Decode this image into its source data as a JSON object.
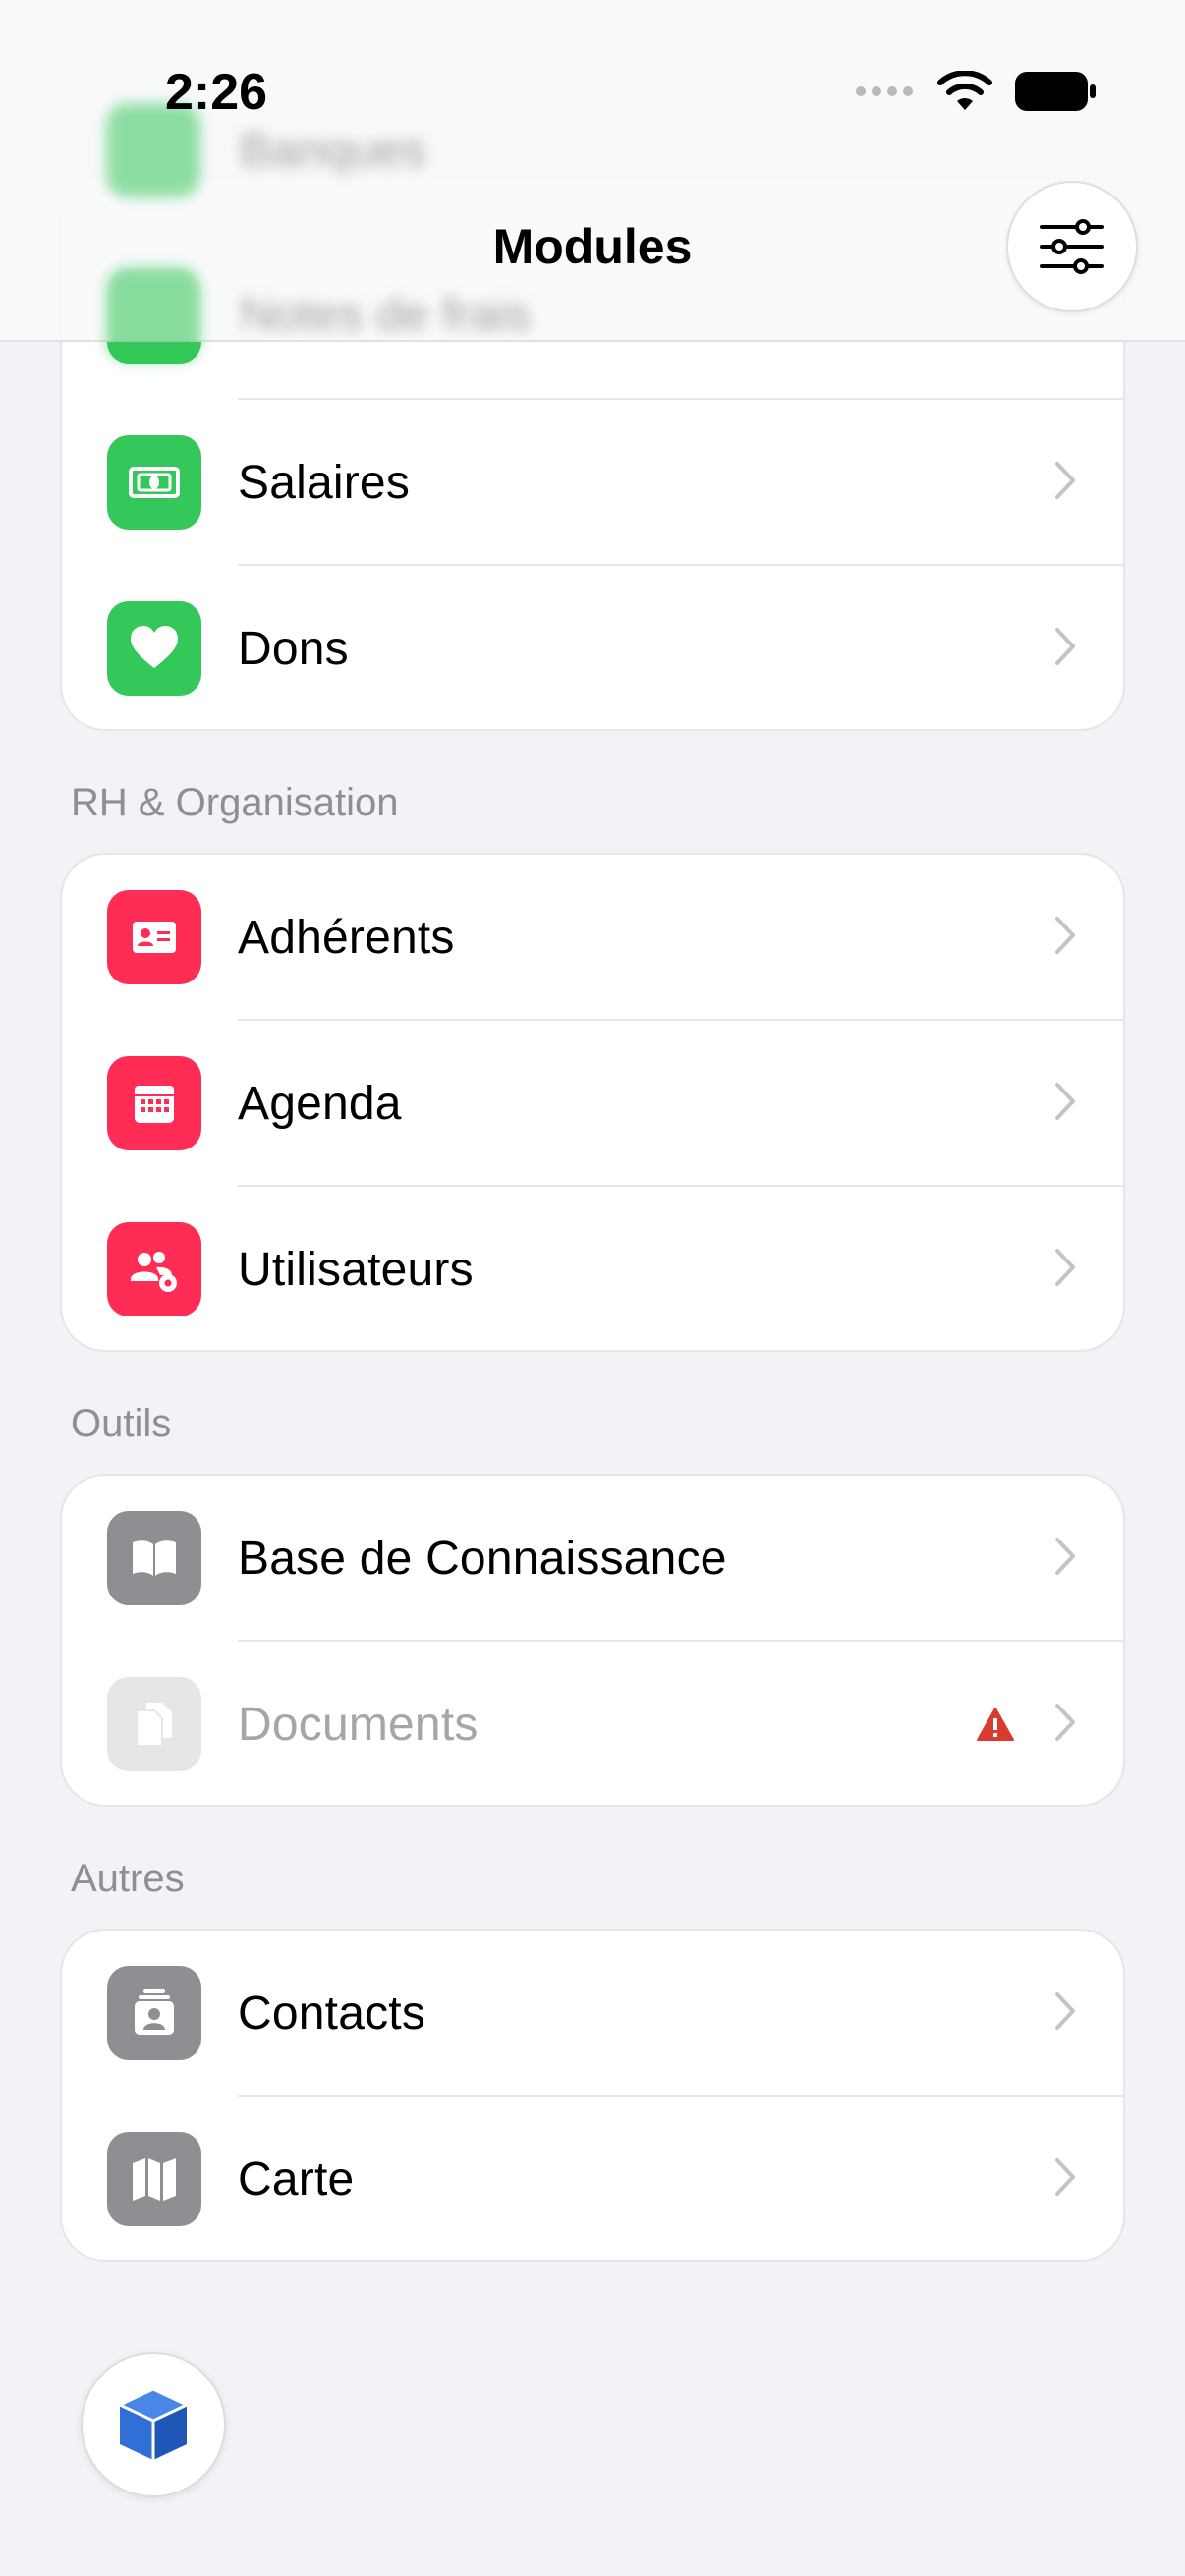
{
  "status": {
    "time": "2:26"
  },
  "nav": {
    "title": "Modules",
    "filter_icon": "sliders-icon"
  },
  "behind_header": {
    "item1": "Banques",
    "item2": "Notes de frais"
  },
  "sections": {
    "finance": {
      "items": [
        {
          "label": "Salaires",
          "icon": "banknote-icon"
        },
        {
          "label": "Dons",
          "icon": "heart-icon"
        }
      ]
    },
    "rh": {
      "title": "RH & Organisation",
      "items": [
        {
          "label": "Adhérents",
          "icon": "id-card-icon"
        },
        {
          "label": "Agenda",
          "icon": "calendar-icon"
        },
        {
          "label": "Utilisateurs",
          "icon": "users-gear-icon"
        }
      ]
    },
    "outils": {
      "title": "Outils",
      "items": [
        {
          "label": "Base de Connaissance",
          "icon": "book-icon"
        },
        {
          "label": "Documents",
          "icon": "documents-icon",
          "warning": "warning-icon"
        }
      ]
    },
    "autres": {
      "title": "Autres",
      "items": [
        {
          "label": "Contacts",
          "icon": "contact-card-icon"
        },
        {
          "label": "Carte",
          "icon": "map-icon"
        }
      ]
    }
  },
  "colors": {
    "green": "#34c759",
    "red": "#ff2d55",
    "gray": "#8e8e93",
    "warning": "#d93b30",
    "fab_icon": "#2f6fd6"
  },
  "fab": {
    "icon": "cube-icon"
  }
}
